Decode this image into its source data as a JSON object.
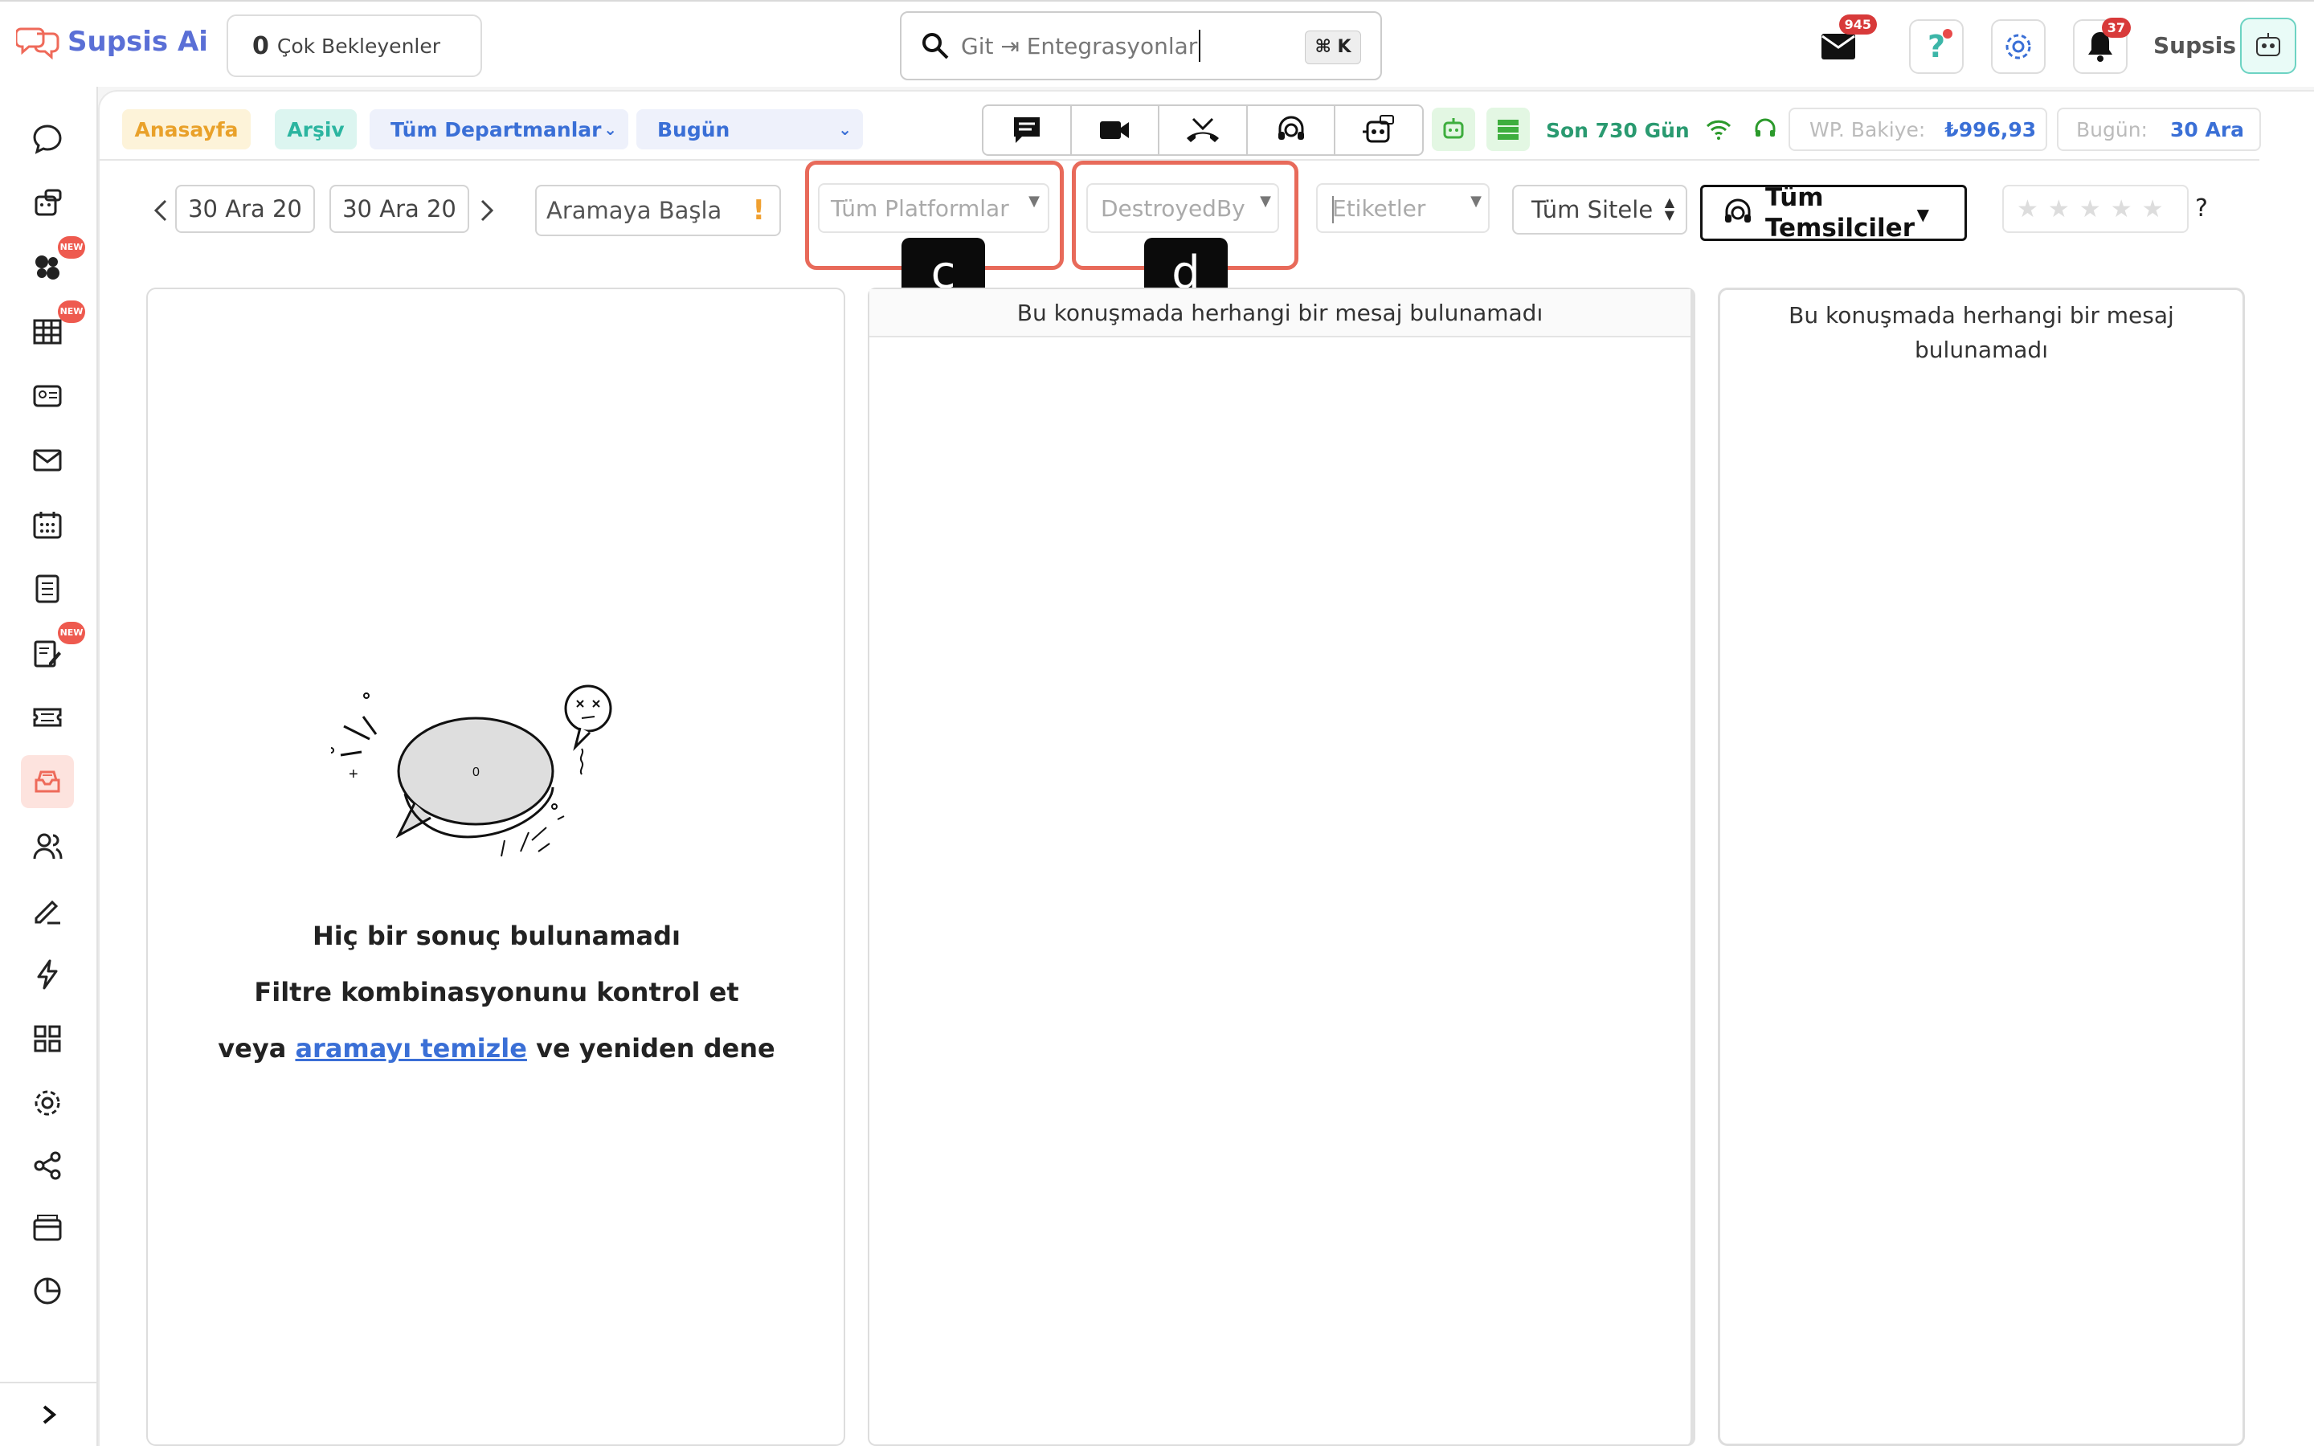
{
  "app": {
    "name": "Supsis Ai",
    "user_name": "Supsis"
  },
  "topbar": {
    "pending_count": "0",
    "pending_label": "Çok Bekleyenler",
    "search_placeholder": "Git ⇥ Entegrasyonlar",
    "search_shortcut": "⌘ K",
    "mail_badge": "945",
    "notification_badge": "37"
  },
  "nav": {
    "home": "Anasayfa",
    "archive": "Arşiv",
    "departments": "Tüm Departmanlar",
    "today": "Bugün",
    "last_days": "Son 730 Gün",
    "wp_balance_label": "WP. Bakiye:",
    "wp_balance_value": "₺996,93",
    "today_label": "Bugün:",
    "today_value": "30 Ara"
  },
  "filters": {
    "date_from": "30 Ara 20",
    "date_to": "30 Ara 20",
    "search_placeholder": "Aramaya Başla",
    "platforms": "Tüm Platformlar",
    "destroyed_by": "DestroyedBy",
    "tags": "Etiketler",
    "site": "Tüm Sitele",
    "agents": "Tüm Temsilciler",
    "rating_help": "?"
  },
  "annotations": {
    "c": "c",
    "d": "d"
  },
  "panels": {
    "empty_title": "Hiç bir sonuç bulunamadı",
    "empty_line2": "Filtre kombinasyonunu kontrol et",
    "empty_line3_prefix": "veya",
    "empty_line3_link": "aramayı temizle",
    "empty_line3_suffix": "ve yeniden dene",
    "no_message_middle": "Bu konuşmada herhangi bir mesaj bulunamadı",
    "no_message_right": "Bu konuşmada herhangi bir mesaj bulunamadı",
    "illustration_zero": "0"
  },
  "sidebar": {
    "new_label": "NEW"
  },
  "colors": {
    "accent": "#5a6fd6",
    "badge_red": "#d83a3a",
    "callout": "#e86a5a",
    "active_bg": "#fde3de"
  }
}
